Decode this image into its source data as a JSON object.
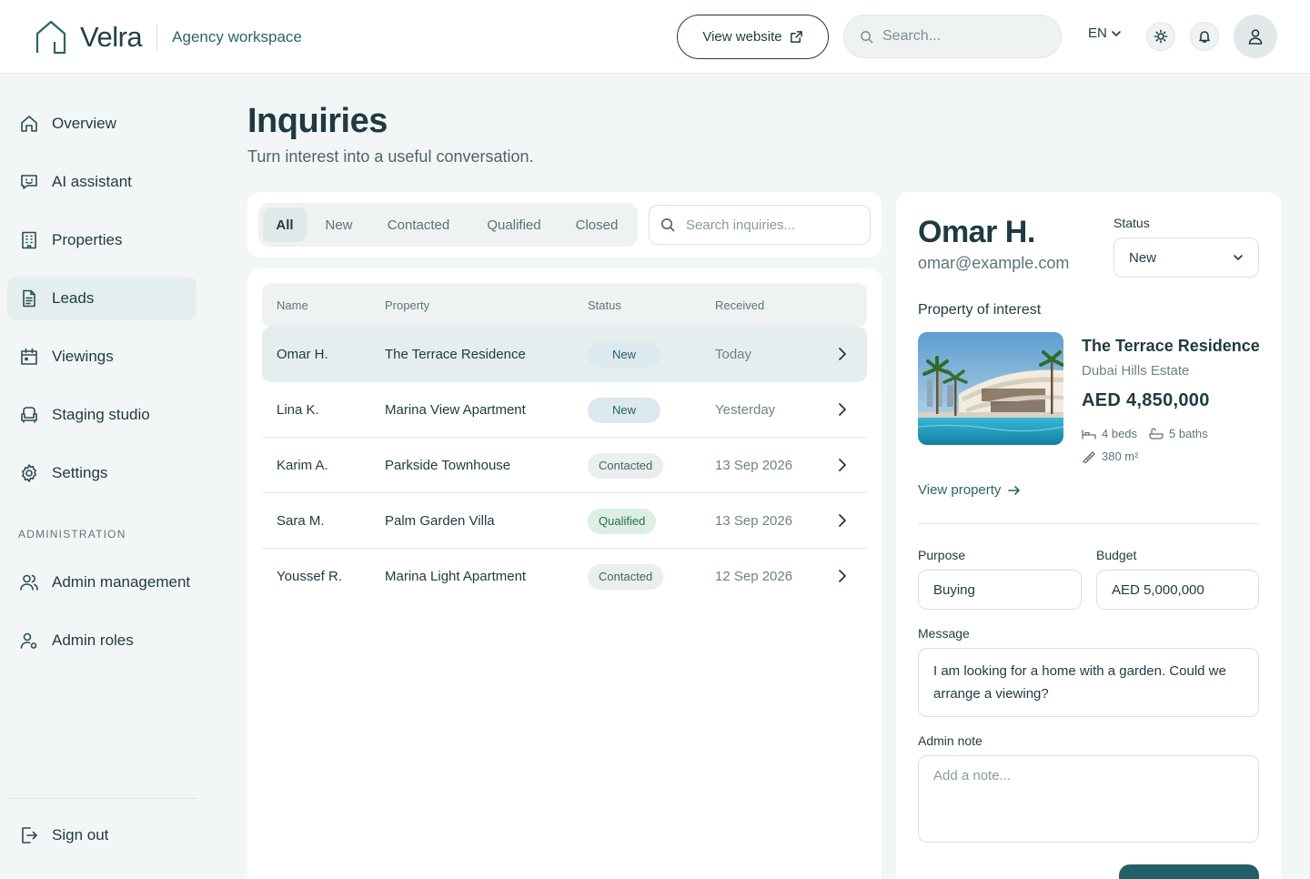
{
  "header": {
    "brand_name": "Velra",
    "brand_sub": "Agency workspace",
    "view_website": "View website",
    "search_placeholder": "Search...",
    "language": "EN"
  },
  "sidebar": {
    "items": [
      {
        "label": "Overview",
        "icon": "home-icon"
      },
      {
        "label": "AI assistant",
        "icon": "chat-bot-icon"
      },
      {
        "label": "Properties",
        "icon": "building-icon"
      },
      {
        "label": "Leads",
        "icon": "document-icon",
        "active": true
      },
      {
        "label": "Viewings",
        "icon": "calendar-icon"
      },
      {
        "label": "Staging studio",
        "icon": "sofa-icon"
      },
      {
        "label": "Settings",
        "icon": "gear-icon"
      }
    ],
    "admin_section": "ADMINISTRATION",
    "admin_items": [
      {
        "label": "Admin management",
        "icon": "users-icon"
      },
      {
        "label": "Admin roles",
        "icon": "user-shield-icon"
      }
    ],
    "sign_out": "Sign out"
  },
  "page": {
    "title": "Inquiries",
    "subtitle": "Turn interest into a useful conversation."
  },
  "filters": {
    "tabs": [
      "All",
      "New",
      "Contacted",
      "Qualified",
      "Closed"
    ],
    "active_tab": "All",
    "search_placeholder": "Search inquiries..."
  },
  "table": {
    "columns": [
      "Name",
      "Property",
      "Status",
      "Received"
    ],
    "rows": [
      {
        "name": "Omar H.",
        "property": "The Terrace Residence",
        "status": "New",
        "received": "Today"
      },
      {
        "name": "Lina K.",
        "property": "Marina View Apartment",
        "status": "New",
        "received": "Yesterday"
      },
      {
        "name": "Karim A.",
        "property": "Parkside Townhouse",
        "status": "Contacted",
        "received": "13 Sep 2026"
      },
      {
        "name": "Sara M.",
        "property": "Palm Garden Villa",
        "status": "Qualified",
        "received": "13 Sep 2026"
      },
      {
        "name": "Youssef R.",
        "property": "Marina Light Apartment",
        "status": "Contacted",
        "received": "12 Sep 2026"
      }
    ]
  },
  "detail": {
    "name": "Omar H.",
    "email": "omar@example.com",
    "status_label": "Status",
    "status_value": "New",
    "poi_label": "Property of interest",
    "property": {
      "title": "The Terrace Residence",
      "location": "Dubai Hills Estate",
      "price": "AED 4,850,000",
      "beds": "4 beds",
      "baths": "5 baths",
      "area": "380 m²"
    },
    "view_property": "View property",
    "purpose_label": "Purpose",
    "purpose_value": "Buying",
    "budget_label": "Budget",
    "budget_value": "AED 5,000,000",
    "message_label": "Message",
    "message": "I am looking for a home with a garden. Could we arrange a viewing?",
    "note_label": "Admin note",
    "note_placeholder": "Add a note..."
  },
  "colors": {
    "accent": "#235f66",
    "background": "#f3f6f6",
    "text": "#1f3a40"
  }
}
